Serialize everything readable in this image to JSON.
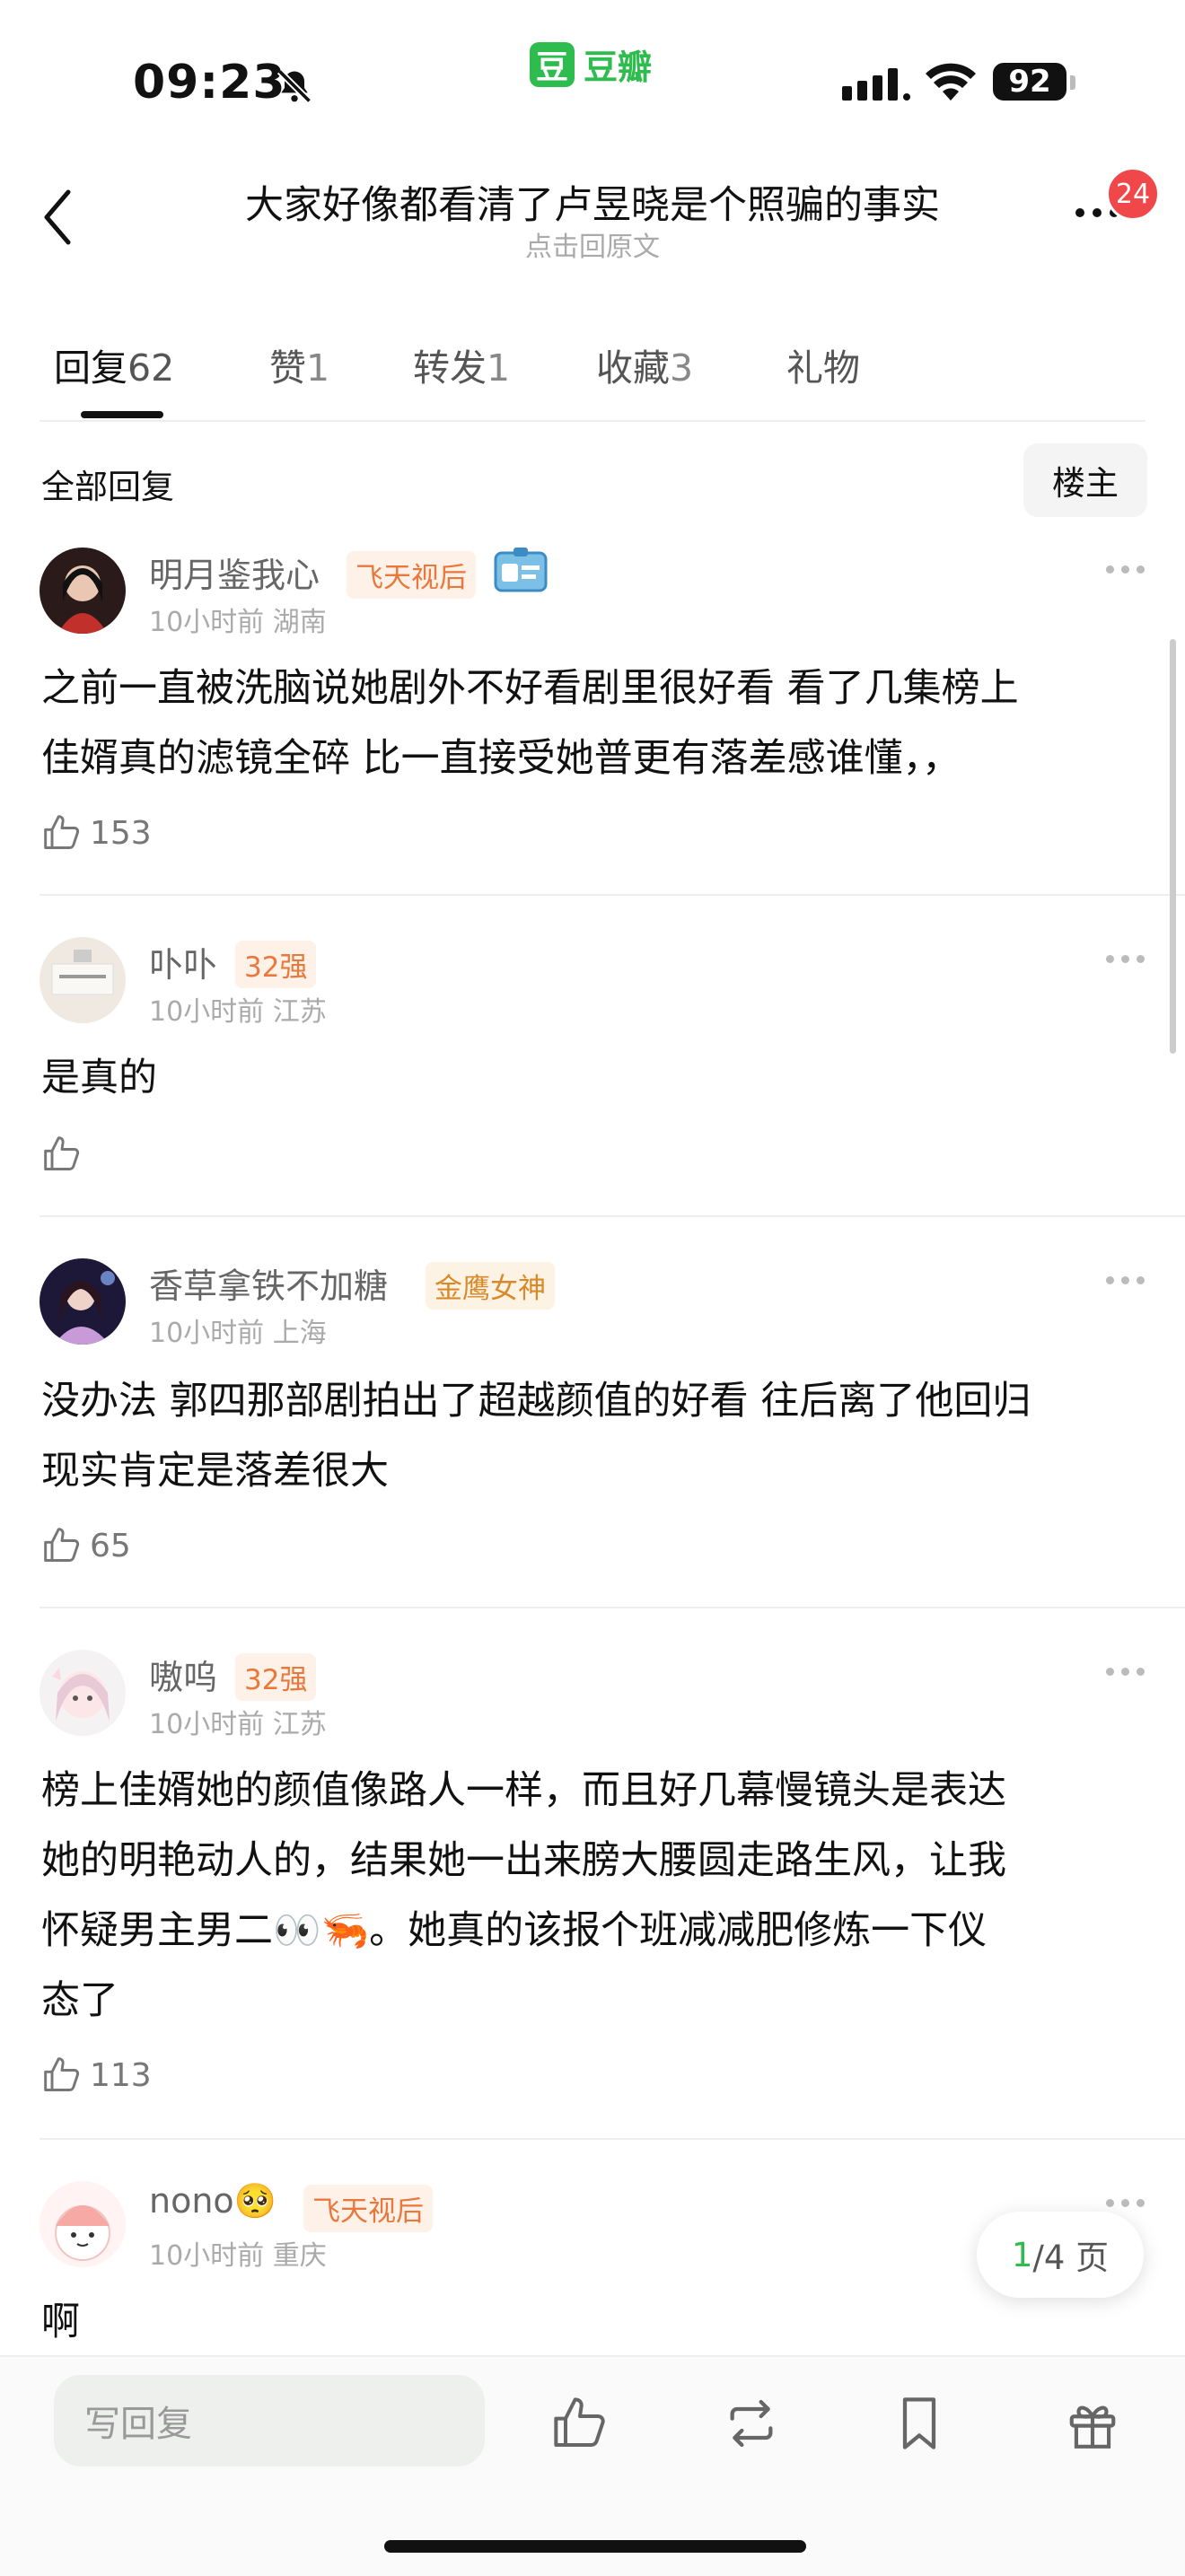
{
  "status": {
    "time": "09:23",
    "battery": "92",
    "app_name": "豆瓣",
    "app_logo": "豆"
  },
  "nav": {
    "title": "大家好像都看清了卢昱晓是个照骗的事实",
    "subtitle": "点击回原文",
    "badge": "24"
  },
  "tabs": [
    {
      "label": "回复",
      "count": "62"
    },
    {
      "label": "赞",
      "count": "1"
    },
    {
      "label": "转发",
      "count": "1"
    },
    {
      "label": "收藏",
      "count": "3"
    },
    {
      "label": "礼物",
      "count": ""
    }
  ],
  "section": {
    "all_replies": "全部回复",
    "owner_filter": "楼主"
  },
  "comments": [
    {
      "user": "明月鉴我心",
      "tag": "飞天视后",
      "time": "10小时前",
      "location": "湖南",
      "text_lines": [
        "之前一直被洗脑说她剧外不好看剧里很好看 看了几集榜上",
        "佳婿真的滤镜全碎 比一直接受她普更有落差感谁懂，，"
      ],
      "likes": "153"
    },
    {
      "user": "卟卟",
      "tag": "32强",
      "time": "10小时前",
      "location": "江苏",
      "text_lines": [
        "是真的"
      ],
      "likes": ""
    },
    {
      "user": "香草拿铁不加糖",
      "tag": "金鹰女神",
      "time": "10小时前",
      "location": "上海",
      "text_lines": [
        "没办法 郭四那部剧拍出了超越颜值的好看 往后离了他回归",
        "现实肯定是落差很大"
      ],
      "likes": "65"
    },
    {
      "user": "嗷呜",
      "tag": "32强",
      "time": "10小时前",
      "location": "江苏",
      "text_lines": [
        "榜上佳婿她的颜值像路人一样，而且好几幕慢镜头是表达",
        "她的明艳动人的，结果她一出来膀大腰圆走路生风，让我",
        "怀疑男主男二👀🦐。她真的该报个班减减肥修炼一下仪",
        "态了"
      ],
      "likes": "113"
    },
    {
      "user": "nono",
      "emoji": "🥺",
      "tag": "飞天视后",
      "time": "10小时前",
      "location": "重庆",
      "text_lines": [
        "啊"
      ],
      "likes": ""
    }
  ],
  "pager": {
    "current": "1",
    "total": "/4 页"
  },
  "bottom": {
    "reply_placeholder": "写回复"
  }
}
